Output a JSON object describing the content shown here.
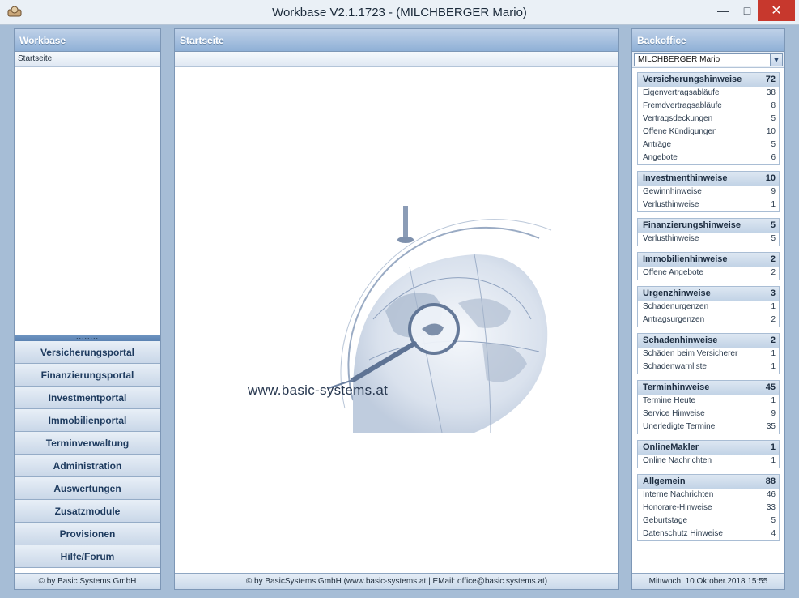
{
  "window": {
    "title": "Workbase V2.1.1723  -  (MILCHBERGER Mario)",
    "min_label": "—",
    "max_label": "□",
    "close_label": "✕"
  },
  "left": {
    "header": "Workbase",
    "tree_item": "Startseite",
    "splitter_label": "::::::::",
    "nav": [
      "Versicherungsportal",
      "Finanzierungsportal",
      "Investmentportal",
      "Immobilienportal",
      "Terminverwaltung",
      "Administration",
      "Auswertungen",
      "Zusatzmodule",
      "Provisionen",
      "Hilfe/Forum"
    ],
    "footer": "© by Basic Systems GmbH"
  },
  "middle": {
    "header": "Startseite",
    "logo_text": "www.basic-systems.at",
    "footer": "© by BasicSystems GmbH (www.basic-systems.at | EMail: office@basic.systems.at)"
  },
  "right": {
    "header": "Backoffice",
    "user_select": "MILCHBERGER Mario",
    "sections": [
      {
        "title": "Versicherungshinweise",
        "count": "72",
        "rows": [
          {
            "label": "Eigenvertragsabläufe",
            "count": "38"
          },
          {
            "label": "Fremdvertragsabläufe",
            "count": "8"
          },
          {
            "label": "Vertragsdeckungen",
            "count": "5"
          },
          {
            "label": "Offene Kündigungen",
            "count": "10"
          },
          {
            "label": "Anträge",
            "count": "5"
          },
          {
            "label": "Angebote",
            "count": "6"
          }
        ]
      },
      {
        "title": "Investmenthinweise",
        "count": "10",
        "rows": [
          {
            "label": "Gewinnhinweise",
            "count": "9"
          },
          {
            "label": "Verlusthinweise",
            "count": "1"
          }
        ]
      },
      {
        "title": "Finanzierungshinweise",
        "count": "5",
        "rows": [
          {
            "label": "Verlusthinweise",
            "count": "5"
          }
        ]
      },
      {
        "title": "Immobilienhinweise",
        "count": "2",
        "rows": [
          {
            "label": "Offene Angebote",
            "count": "2"
          }
        ]
      },
      {
        "title": "Urgenzhinweise",
        "count": "3",
        "rows": [
          {
            "label": "Schadenurgenzen",
            "count": "1"
          },
          {
            "label": "Antragsurgenzen",
            "count": "2"
          }
        ]
      },
      {
        "title": "Schadenhinweise",
        "count": "2",
        "rows": [
          {
            "label": "Schäden beim Versicherer",
            "count": "1"
          },
          {
            "label": "Schadenwarnliste",
            "count": "1"
          }
        ]
      },
      {
        "title": "Terminhinweise",
        "count": "45",
        "rows": [
          {
            "label": "Termine Heute",
            "count": "1"
          },
          {
            "label": "Service Hinweise",
            "count": "9"
          },
          {
            "label": "Unerledigte Termine",
            "count": "35"
          }
        ]
      },
      {
        "title": "OnlineMakler",
        "count": "1",
        "rows": [
          {
            "label": "Online Nachrichten",
            "count": "1"
          }
        ]
      },
      {
        "title": "Allgemein",
        "count": "88",
        "rows": [
          {
            "label": "Interne Nachrichten",
            "count": "46"
          },
          {
            "label": "Honorare-Hinweise",
            "count": "33"
          },
          {
            "label": "Geburtstage",
            "count": "5"
          },
          {
            "label": "Datenschutz Hinweise",
            "count": "4"
          }
        ]
      }
    ],
    "footer": "Mittwoch, 10.Oktober.2018 15:55"
  }
}
